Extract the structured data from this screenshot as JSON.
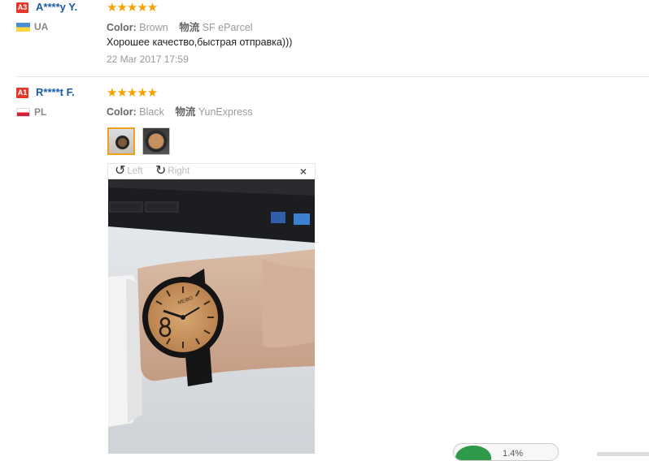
{
  "reviews": [
    {
      "badge": "A3",
      "user": "A****y Y.",
      "country": "UA",
      "stars": "★★★★★",
      "color_key": "Color:",
      "color_val": "Brown",
      "ship_key": "物流",
      "ship_val": "SF eParcel",
      "text": "Хорошее качество,быстрая отправка)))",
      "date": "22 Mar 2017 17:59"
    },
    {
      "badge": "A1",
      "user": "R****t F.",
      "country": "PL",
      "stars": "★★★★★",
      "color_key": "Color:",
      "color_val": "Black",
      "ship_key": "物流",
      "ship_val": "YunExpress"
    }
  ],
  "viewer": {
    "rotate_left_icon": "↺",
    "rotate_left_label": "Left",
    "rotate_right_icon": "↻",
    "rotate_right_label": "Right",
    "close_icon": "×",
    "brand_on_dial": "MEIBO"
  },
  "floating": {
    "text": "1.4%"
  }
}
